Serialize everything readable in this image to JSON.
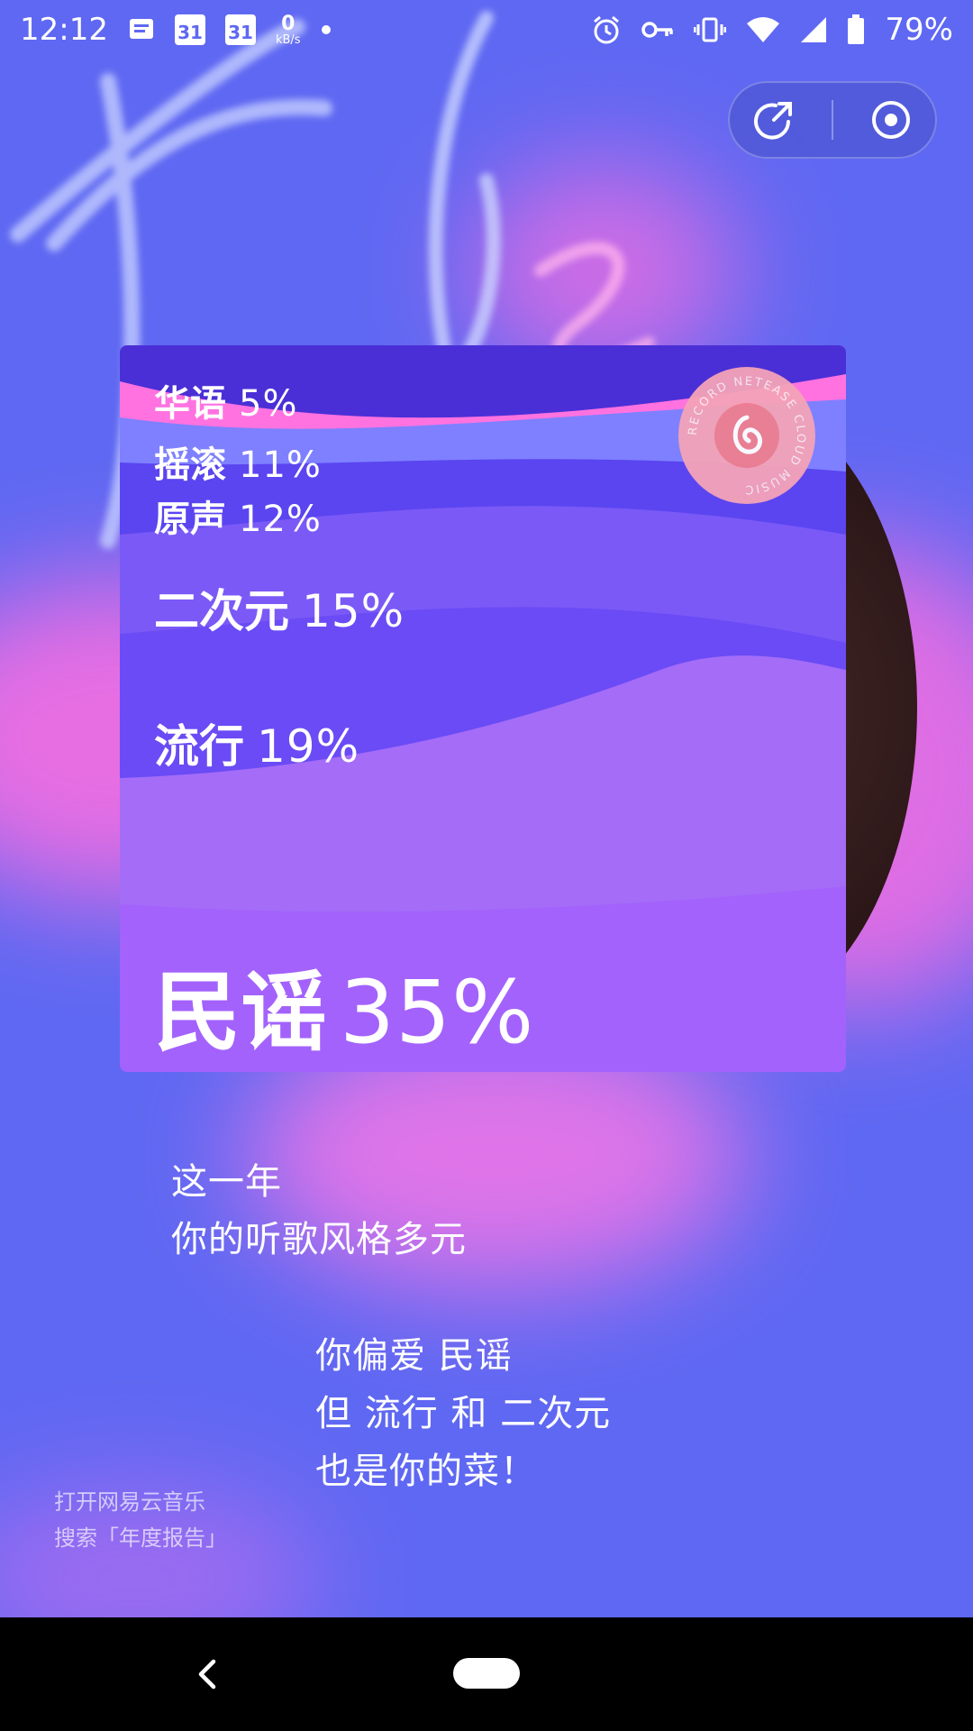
{
  "status_bar": {
    "time": "12:12",
    "calendar_day_1": "31",
    "calendar_day_2": "31",
    "net_speed_value": "0",
    "net_speed_unit": "kB/s",
    "battery": "79%",
    "icons": [
      "message-icon",
      "calendar-icon",
      "calendar-icon",
      "net-speed",
      "dot",
      "alarm-icon",
      "vpn-key-icon",
      "vibrate-icon",
      "wifi-icon",
      "signal-icon",
      "battery-icon"
    ]
  },
  "top_controls": {
    "icons": [
      "share-icon",
      "record-target-icon"
    ]
  },
  "report_card": {
    "genres": [
      {
        "name": "华语",
        "percent": "5%",
        "value": 5
      },
      {
        "name": "摇滚",
        "percent": "11%",
        "value": 11
      },
      {
        "name": "原声",
        "percent": "12%",
        "value": 12
      },
      {
        "name": "二次元",
        "percent": "15%",
        "value": 15
      },
      {
        "name": "流行",
        "percent": "19%",
        "value": 19
      },
      {
        "name": "民谣",
        "percent": "35%",
        "value": 35
      }
    ],
    "badge_text": "RECORD NETEASE CLOUD MUSIC"
  },
  "summary": {
    "line1": "这一年",
    "line2": "你的听歌风格多元",
    "line3": "你偏爱 民谣",
    "line4": "但 流行 和 二次元",
    "line5": "也是你的菜！"
  },
  "hint": {
    "line1": "打开网易云音乐",
    "line2": "搜索「年度报告」"
  },
  "colors": {
    "background": "#5f68f2",
    "card_top": "#4b2fd6",
    "accent_pink": "#ff72e0",
    "vinyl": "#3a2122"
  }
}
